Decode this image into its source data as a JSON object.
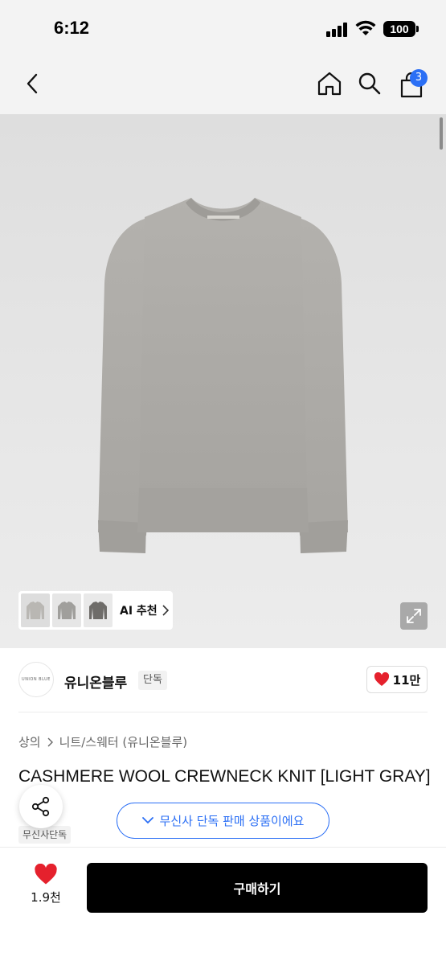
{
  "status_bar": {
    "time": "6:12",
    "battery": "100"
  },
  "nav": {
    "cart_count": "3"
  },
  "gallery": {
    "ai_recommend_label": "AI 추천"
  },
  "brand": {
    "logo_text": "UNION BLUE",
    "name": "유니온블루",
    "exclusive_chip": "단독",
    "likes": "11만"
  },
  "breadcrumb": {
    "category": "상의",
    "subcategory": "니트/스웨터 (유니온블루)"
  },
  "product": {
    "title": "CASHMERE WOOL CREWNECK KNIT [LIGHT GRAY]",
    "tag": "무신사단독"
  },
  "notice": {
    "text": "무신사 단독 판매 상품이에요"
  },
  "bottom_bar": {
    "wish_count": "1.9천",
    "buy_label": "구매하기"
  },
  "colors": {
    "accent_blue": "#2b6ff5",
    "heart_red": "#e5212d",
    "buy_black": "#000000"
  }
}
